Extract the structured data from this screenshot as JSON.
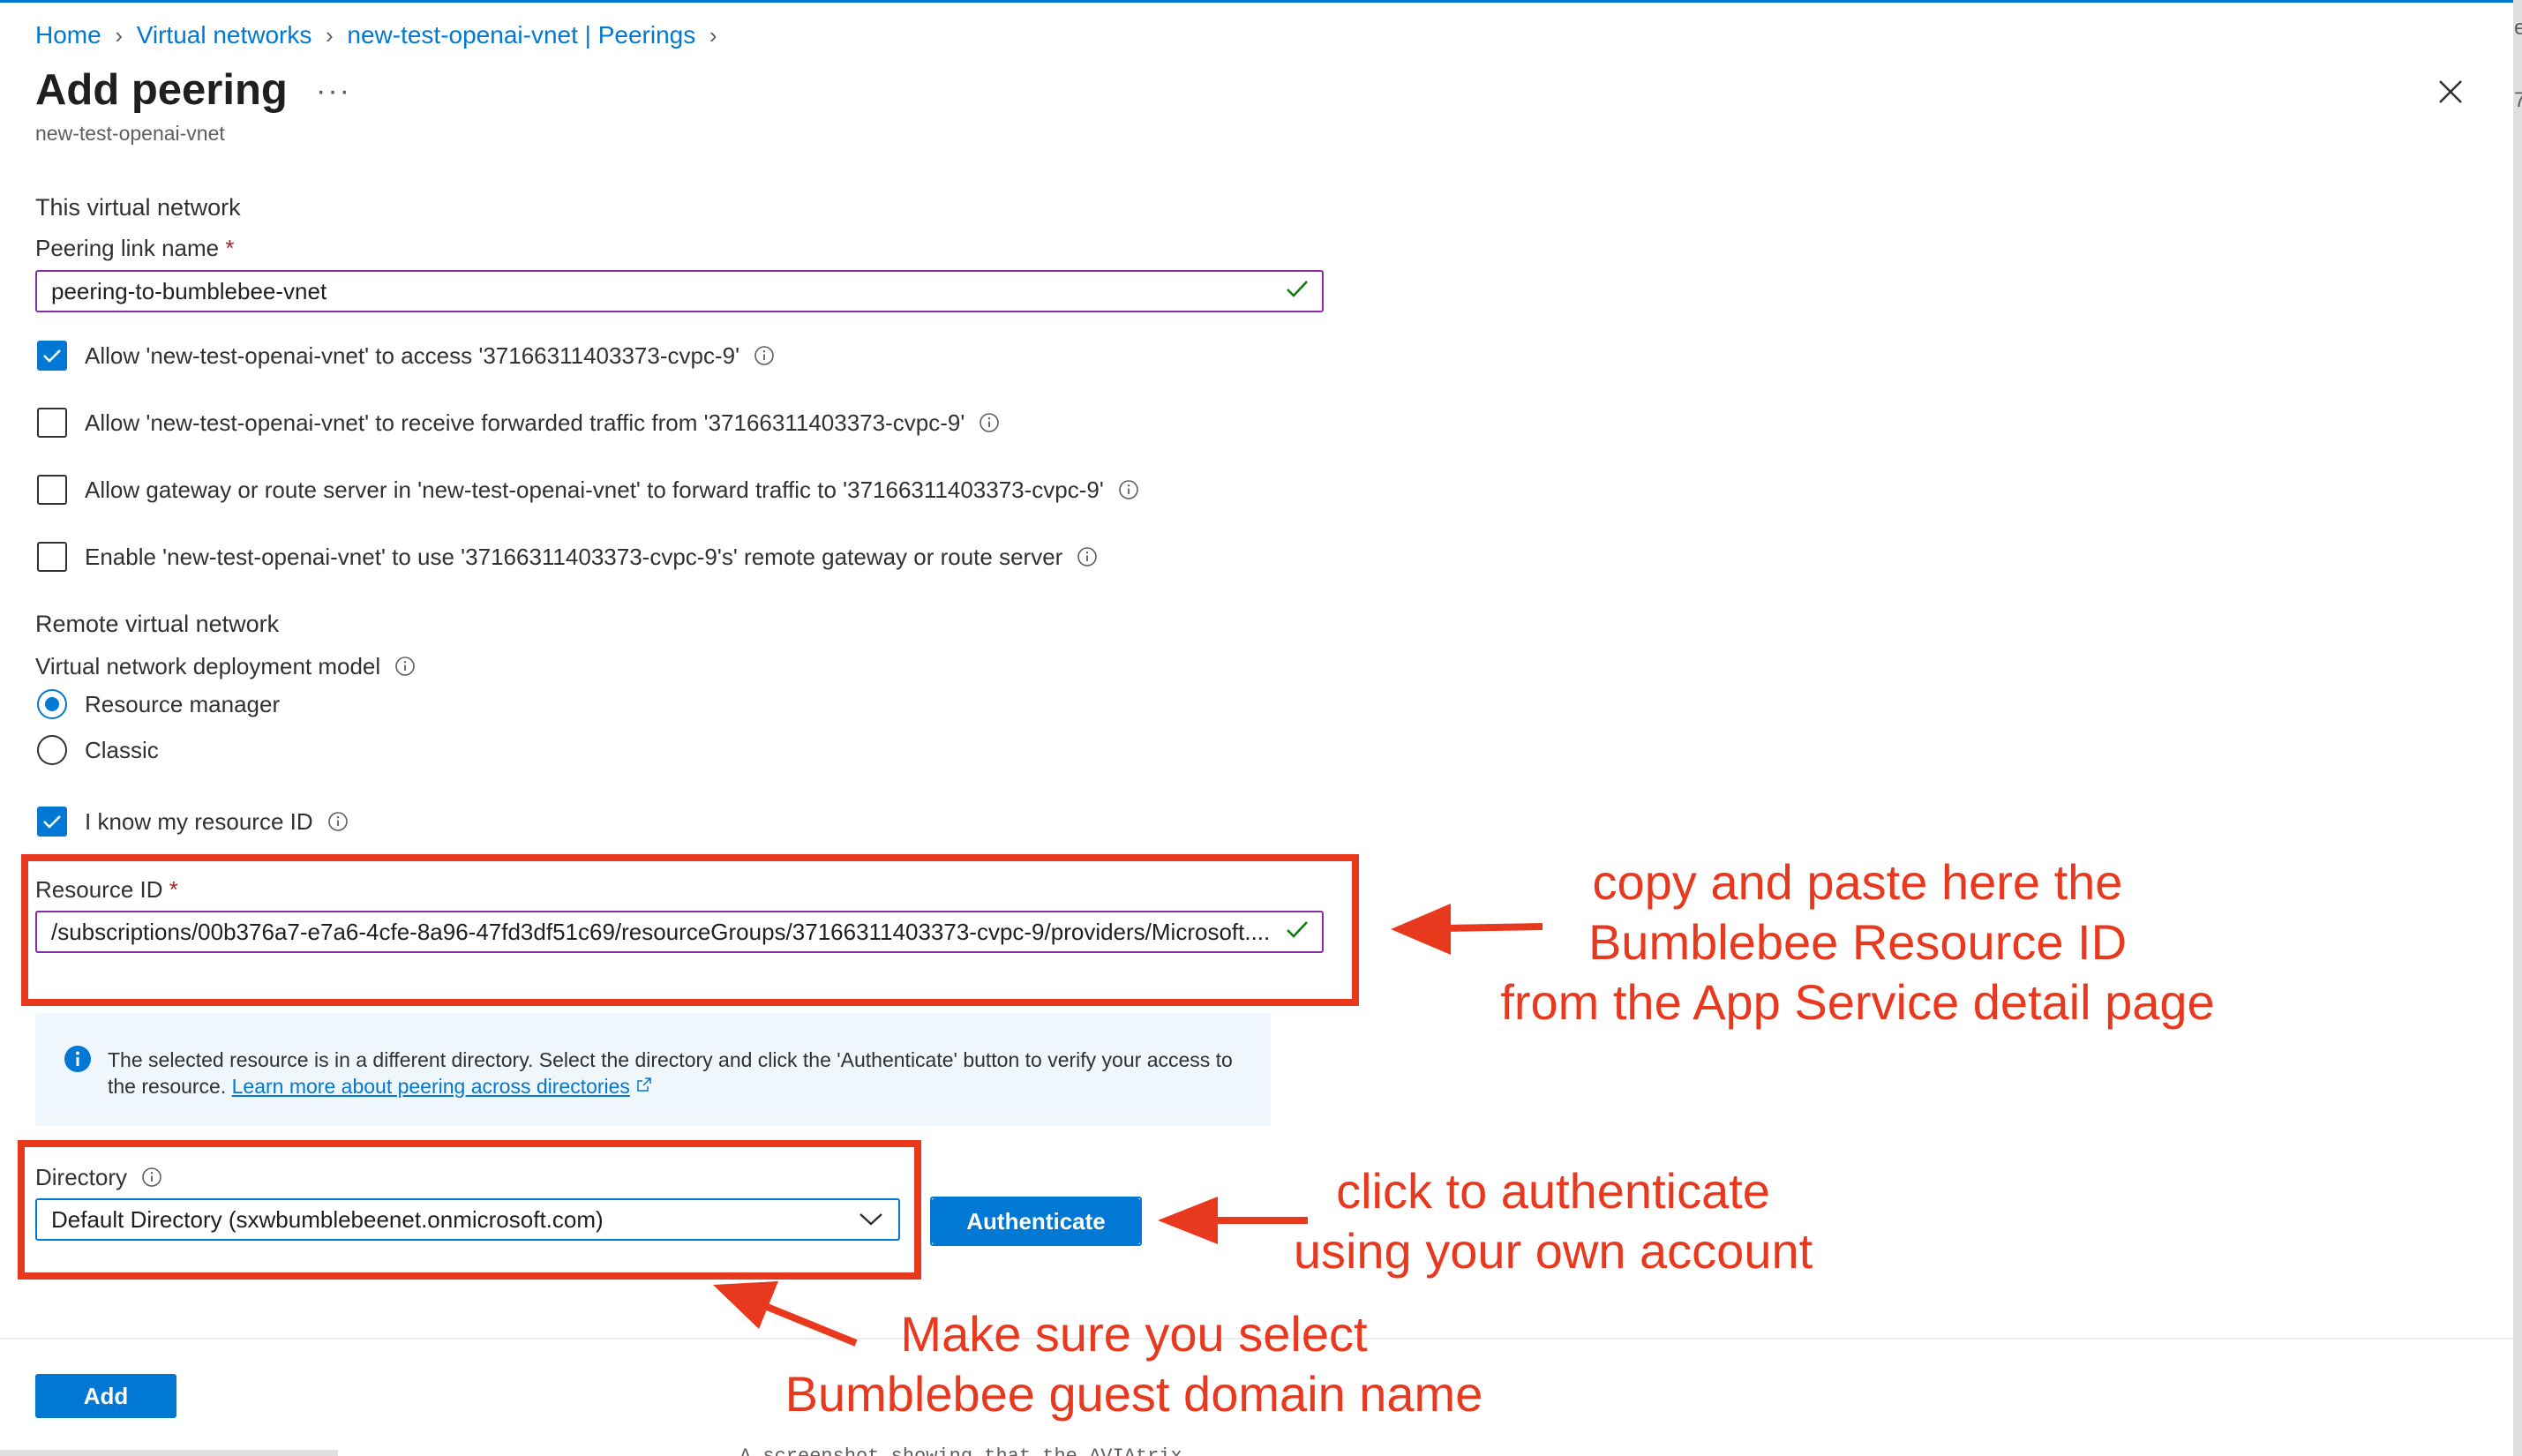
{
  "breadcrumb": {
    "items": [
      "Home",
      "Virtual networks",
      "new-test-openai-vnet | Peerings"
    ]
  },
  "header": {
    "title": "Add peering",
    "more_label": "···",
    "subtitle": "new-test-openai-vnet"
  },
  "this_network": {
    "section_title": "This virtual network",
    "peering_link_label": "Peering link name",
    "required_mark": "*",
    "peering_link_value": "peering-to-bumblebee-vnet",
    "options": [
      {
        "label": "Allow 'new-test-openai-vnet' to access '37166311403373-cvpc-9'",
        "checked": true
      },
      {
        "label": "Allow 'new-test-openai-vnet' to receive forwarded traffic from '37166311403373-cvpc-9'",
        "checked": false
      },
      {
        "label": "Allow gateway or route server in 'new-test-openai-vnet' to forward traffic to '37166311403373-cvpc-9'",
        "checked": false
      },
      {
        "label": "Enable 'new-test-openai-vnet' to use '37166311403373-cvpc-9's' remote gateway or route server",
        "checked": false
      }
    ]
  },
  "remote_network": {
    "section_title": "Remote virtual network",
    "deployment_model_label": "Virtual network deployment model",
    "models": [
      {
        "label": "Resource manager",
        "selected": true
      },
      {
        "label": "Classic",
        "selected": false
      }
    ],
    "know_resource_id_label": "I know my resource ID",
    "know_resource_id_checked": true,
    "resource_id_label": "Resource ID",
    "resource_id_value": "/subscriptions/00b376a7-e7a6-4cfe-8a96-47fd3df51c69/resourceGroups/37166311403373-cvpc-9/providers/Microsoft...."
  },
  "info_banner": {
    "text": "The selected resource is in a different directory. Select the directory and click the 'Authenticate' button to verify your access to the resource.",
    "link": "Learn more about peering across directories"
  },
  "directory": {
    "label": "Directory",
    "selected": "Default Directory (sxwbumblebeenet.onmicrosoft.com)",
    "authenticate_label": "Authenticate"
  },
  "footer": {
    "add_label": "Add"
  },
  "annotations": {
    "resource_id_note": [
      "copy and paste here the",
      "Bumblebee Resource ID",
      "from the App Service detail page"
    ],
    "authenticate_note": [
      "click to authenticate",
      "using your own account"
    ],
    "directory_note": [
      "Make sure you select",
      "Bumblebee guest domain name"
    ]
  },
  "colors": {
    "accent": "#0078d4",
    "annotation_red": "#e8391f",
    "focus_border": "#8a2da5",
    "check_green": "#107c10"
  },
  "edge_fragments": {
    "right_top": "e",
    "right_mid": "7",
    "bottom_partial": "A screenshot showing that the AVIAtrix"
  }
}
